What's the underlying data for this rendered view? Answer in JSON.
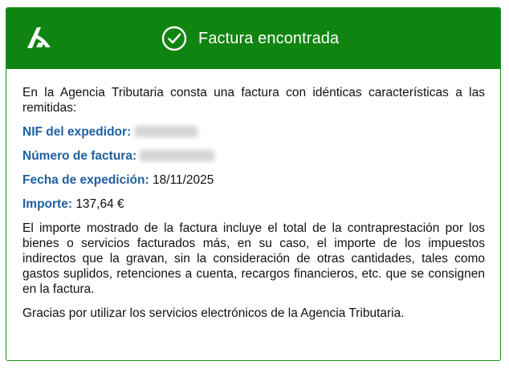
{
  "header": {
    "logo_icon": "agencia-tributaria-logo",
    "status_icon": "check-circle-icon",
    "title": "Factura encontrada",
    "background_color": "#108410"
  },
  "body": {
    "intro": "En la Agencia Tributaria consta una factura con idénticas características a las remitidas:",
    "fields": {
      "nif": {
        "label": "NIF del expedidor:",
        "value": ""
      },
      "numero": {
        "label": "Número de factura:",
        "value": ""
      },
      "fecha": {
        "label": "Fecha de expedición:",
        "value": "18/11/2025"
      },
      "importe": {
        "label": "Importe:",
        "value": "137,64 €"
      }
    },
    "label_color": "#1f5f9f",
    "description": "El importe mostrado de la factura incluye el total de la contraprestación por los bienes o servicios facturados más, en su caso, el importe de los impuestos indirectos que la gravan, sin la consideración de otras cantidades, tales como gastos suplidos, retenciones a cuenta, recargos financieros, etc. que se consignen en la factura.",
    "thanks": "Gracias por utilizar los servicios electrónicos de la Agencia Tributaria."
  }
}
